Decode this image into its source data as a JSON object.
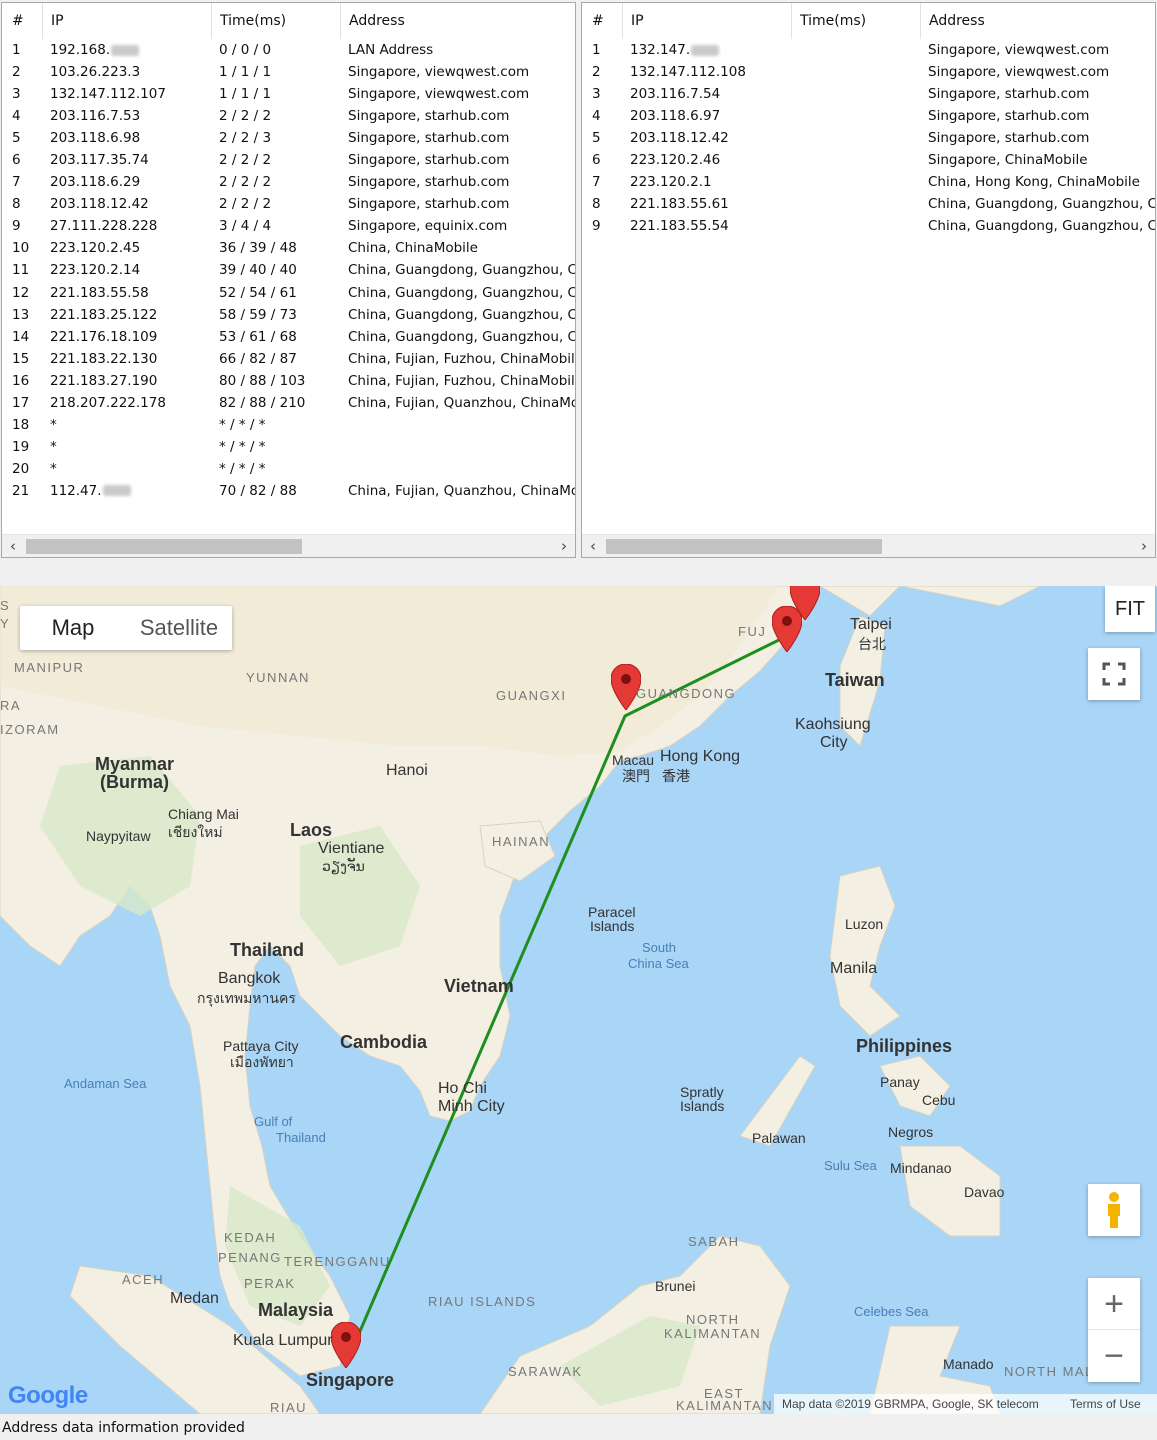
{
  "left_table": {
    "columns": [
      "#",
      "IP",
      "Time(ms)",
      "Address"
    ],
    "rows": [
      {
        "n": "1",
        "ip": "192.168.",
        "masked": true,
        "time": "0 / 0 / 0",
        "addr": "LAN Address"
      },
      {
        "n": "2",
        "ip": "103.26.223.3",
        "masked": false,
        "time": "1 / 1 / 1",
        "addr": "Singapore, viewqwest.com"
      },
      {
        "n": "3",
        "ip": "132.147.112.107",
        "masked": false,
        "time": "1 / 1 / 1",
        "addr": "Singapore, viewqwest.com"
      },
      {
        "n": "4",
        "ip": "203.116.7.53",
        "masked": false,
        "time": "2 / 2 / 2",
        "addr": "Singapore, starhub.com"
      },
      {
        "n": "5",
        "ip": "203.118.6.98",
        "masked": false,
        "time": "2 / 2 / 3",
        "addr": "Singapore, starhub.com"
      },
      {
        "n": "6",
        "ip": "203.117.35.74",
        "masked": false,
        "time": "2 / 2 / 2",
        "addr": "Singapore, starhub.com"
      },
      {
        "n": "7",
        "ip": "203.118.6.29",
        "masked": false,
        "time": "2 / 2 / 2",
        "addr": "Singapore, starhub.com"
      },
      {
        "n": "8",
        "ip": "203.118.12.42",
        "masked": false,
        "time": "2 / 2 / 2",
        "addr": "Singapore, starhub.com"
      },
      {
        "n": "9",
        "ip": "27.111.228.228",
        "masked": false,
        "time": "3 / 4 / 4",
        "addr": "Singapore, equinix.com"
      },
      {
        "n": "10",
        "ip": "223.120.2.45",
        "masked": false,
        "time": "36 / 39 / 48",
        "addr": "China, ChinaMobile"
      },
      {
        "n": "11",
        "ip": "223.120.2.14",
        "masked": false,
        "time": "39 / 40 / 40",
        "addr": "China, Guangdong, Guangzhou, Chi"
      },
      {
        "n": "12",
        "ip": "221.183.55.58",
        "masked": false,
        "time": "52 / 54 / 61",
        "addr": "China, Guangdong, Guangzhou, Chi"
      },
      {
        "n": "13",
        "ip": "221.183.25.122",
        "masked": false,
        "time": "58 / 59 / 73",
        "addr": "China, Guangdong, Guangzhou, Chi"
      },
      {
        "n": "14",
        "ip": "221.176.18.109",
        "masked": false,
        "time": "53 / 61 / 68",
        "addr": "China, Guangdong, Guangzhou, Chi"
      },
      {
        "n": "15",
        "ip": "221.183.22.130",
        "masked": false,
        "time": "66 / 82 / 87",
        "addr": "China, Fujian, Fuzhou, ChinaMobile"
      },
      {
        "n": "16",
        "ip": "221.183.27.190",
        "masked": false,
        "time": "80 / 88 / 103",
        "addr": "China, Fujian, Fuzhou, ChinaMobile"
      },
      {
        "n": "17",
        "ip": "218.207.222.178",
        "masked": false,
        "time": "82 / 88 / 210",
        "addr": "China, Fujian, Quanzhou, ChinaMob"
      },
      {
        "n": "18",
        "ip": "*",
        "masked": false,
        "time": "* / * / *",
        "addr": ""
      },
      {
        "n": "19",
        "ip": "*",
        "masked": false,
        "time": "* / * / *",
        "addr": ""
      },
      {
        "n": "20",
        "ip": "*",
        "masked": false,
        "time": "* / * / *",
        "addr": ""
      },
      {
        "n": "21",
        "ip": "112.47.",
        "masked": true,
        "time": "70 / 82 / 88",
        "addr": "China, Fujian, Quanzhou, ChinaMob"
      }
    ]
  },
  "right_table": {
    "columns": [
      "#",
      "IP",
      "Time(ms)",
      "Address"
    ],
    "rows": [
      {
        "n": "1",
        "ip": "132.147.",
        "masked": true,
        "time": "",
        "addr": "Singapore, viewqwest.com"
      },
      {
        "n": "2",
        "ip": "132.147.112.108",
        "masked": false,
        "time": "",
        "addr": "Singapore, viewqwest.com"
      },
      {
        "n": "3",
        "ip": "203.116.7.54",
        "masked": false,
        "time": "",
        "addr": "Singapore, starhub.com"
      },
      {
        "n": "4",
        "ip": "203.118.6.97",
        "masked": false,
        "time": "",
        "addr": "Singapore, starhub.com"
      },
      {
        "n": "5",
        "ip": "203.118.12.42",
        "masked": false,
        "time": "",
        "addr": "Singapore, starhub.com"
      },
      {
        "n": "6",
        "ip": "223.120.2.46",
        "masked": false,
        "time": "",
        "addr": "Singapore, ChinaMobile"
      },
      {
        "n": "7",
        "ip": "223.120.2.1",
        "masked": false,
        "time": "",
        "addr": "China, Hong Kong, ChinaMobile"
      },
      {
        "n": "8",
        "ip": "221.183.55.61",
        "masked": false,
        "time": "",
        "addr": "China, Guangdong, Guangzhou, Chi"
      },
      {
        "n": "9",
        "ip": "221.183.55.54",
        "masked": false,
        "time": "",
        "addr": "China, Guangdong, Guangzhou, Chi"
      }
    ]
  },
  "scroll": {
    "left_arrow": "‹",
    "right_arrow": "›"
  },
  "map": {
    "type_map": "Map",
    "type_satellite": "Satellite",
    "fit": "FIT",
    "zoom_in": "+",
    "zoom_out": "−",
    "route_color": "#1e8f1e",
    "marker_color": "#e53935",
    "logo": "Google",
    "attribution": "Map data ©2019 GBRMPA, Google, SK telecom",
    "terms": "Terms of Use",
    "labels": [
      {
        "t": "Myanmar",
        "c": "big"
      },
      {
        "t": "(Burma)",
        "c": "big"
      },
      {
        "t": "Laos",
        "c": "big"
      },
      {
        "t": "Thailand",
        "c": "big"
      },
      {
        "t": "Vietnam",
        "c": "big"
      },
      {
        "t": "Cambodia",
        "c": "big"
      },
      {
        "t": "Taiwan",
        "c": "big"
      },
      {
        "t": "Philippines",
        "c": "big"
      },
      {
        "t": "Malaysia",
        "c": "big"
      },
      {
        "t": "Singapore",
        "c": "big"
      },
      {
        "t": "Brunei",
        "c": "city"
      },
      {
        "t": "Hanoi",
        "c": "mid"
      },
      {
        "t": "Vientiane",
        "c": "mid"
      },
      {
        "t": "ວຽງຈັນ",
        "c": "city"
      },
      {
        "t": "Bangkok",
        "c": "mid"
      },
      {
        "t": "กรุงเทพมหานคร",
        "c": "city"
      },
      {
        "t": "Chiang Mai",
        "c": "city"
      },
      {
        "t": "เชียงใหม่",
        "c": "city"
      },
      {
        "t": "Naypyitaw",
        "c": "city"
      },
      {
        "t": "Pattaya City",
        "c": "city"
      },
      {
        "t": "เมืองพัทยา",
        "c": "city"
      },
      {
        "t": "Ho Chi",
        "c": "mid"
      },
      {
        "t": "Minh City",
        "c": "mid"
      },
      {
        "t": "Macau",
        "c": "city"
      },
      {
        "t": "澳門",
        "c": "city"
      },
      {
        "t": "Hong Kong",
        "c": "mid"
      },
      {
        "t": "香港",
        "c": "city"
      },
      {
        "t": "Taipei",
        "c": "mid"
      },
      {
        "t": "台北",
        "c": "city"
      },
      {
        "t": "Kaohsiung",
        "c": "mid"
      },
      {
        "t": "City",
        "c": "mid"
      },
      {
        "t": "Manila",
        "c": "mid"
      },
      {
        "t": "Luzon",
        "c": "city"
      },
      {
        "t": "Panay",
        "c": "city"
      },
      {
        "t": "Cebu",
        "c": "city"
      },
      {
        "t": "Negros",
        "c": "city"
      },
      {
        "t": "Palawan",
        "c": "city"
      },
      {
        "t": "Mindanao",
        "c": "city"
      },
      {
        "t": "Davao",
        "c": "city"
      },
      {
        "t": "Manado",
        "c": "city"
      },
      {
        "t": "Medan",
        "c": "mid"
      },
      {
        "t": "Kuala Lumpur",
        "c": "mid"
      },
      {
        "t": "Paracel",
        "c": "city"
      },
      {
        "t": "Islands",
        "c": "city"
      },
      {
        "t": "Spratly",
        "c": "city"
      },
      {
        "t": "Islands",
        "c": "city"
      },
      {
        "t": "South",
        "c": "sea"
      },
      {
        "t": "China Sea",
        "c": "sea"
      },
      {
        "t": "Andaman Sea",
        "c": "sea"
      },
      {
        "t": "Gulf of",
        "c": "sea"
      },
      {
        "t": "Thailand",
        "c": "sea"
      },
      {
        "t": "Sulu Sea",
        "c": "sea"
      },
      {
        "t": "Celebes Sea",
        "c": "sea"
      },
      {
        "t": "MANIPUR",
        "c": "reg"
      },
      {
        "t": "IZORAM",
        "c": "reg"
      },
      {
        "t": "YUNNAN",
        "c": "reg"
      },
      {
        "t": "GUANGXI",
        "c": "reg"
      },
      {
        "t": "GUANGDONG",
        "c": "reg"
      },
      {
        "t": "FUJ",
        "c": "reg"
      },
      {
        "t": "HAINAN",
        "c": "reg"
      },
      {
        "t": "KEDAH",
        "c": "reg"
      },
      {
        "t": "PENANG",
        "c": "reg"
      },
      {
        "t": "TERENGGANU",
        "c": "reg"
      },
      {
        "t": "PERAK",
        "c": "reg"
      },
      {
        "t": "ACEH",
        "c": "reg"
      },
      {
        "t": "RIAU ISLANDS",
        "c": "reg"
      },
      {
        "t": "SABAH",
        "c": "reg"
      },
      {
        "t": "NORTH",
        "c": "reg"
      },
      {
        "t": "KALIMANTAN",
        "c": "reg"
      },
      {
        "t": "SARAWAK",
        "c": "reg"
      },
      {
        "t": "EAST",
        "c": "reg"
      },
      {
        "t": "KALIMANTAN",
        "c": "reg"
      },
      {
        "t": "NORTH MALU",
        "c": "reg"
      },
      {
        "t": "RIAU",
        "c": "reg"
      },
      {
        "t": "RA",
        "c": "reg"
      },
      {
        "t": "Y",
        "c": "reg"
      },
      {
        "t": "S",
        "c": "reg"
      }
    ]
  },
  "status_bar": "Address data information provided"
}
